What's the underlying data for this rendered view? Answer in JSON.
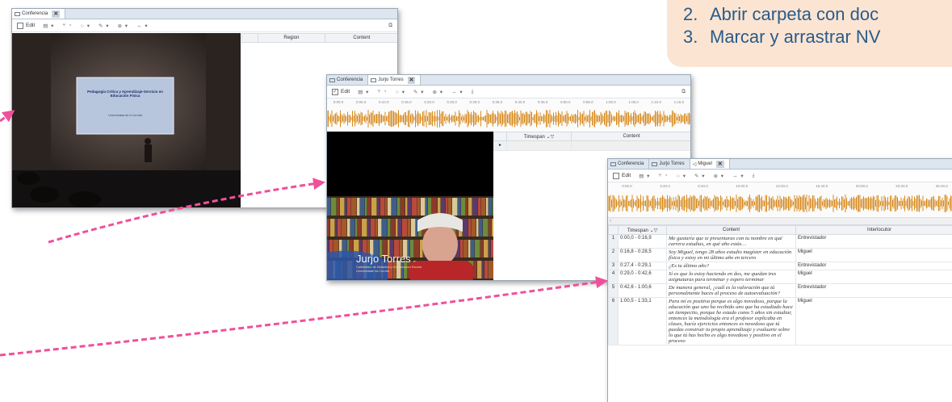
{
  "instructions": {
    "items": [
      {
        "num": "2.",
        "text": "Abrir carpeta con doc"
      },
      {
        "num": "3.",
        "text": "Marcar y arrastrar NV"
      }
    ]
  },
  "win1": {
    "tabs": [
      {
        "label": "Conferencia"
      }
    ],
    "edit_label": "Edit",
    "columns": {
      "region": "Region",
      "content": "Content"
    },
    "video": {
      "slide_title": "Pedagogía Crítica y Aprendizaje-Servicio en Educación Física",
      "slide_sub": "Universidad de A Coruña"
    }
  },
  "win2": {
    "tabs": [
      {
        "label": "Conferencia"
      },
      {
        "label": "Jurjo Torres"
      }
    ],
    "edit_label": "Edit",
    "columns": {
      "timespan": "Timespan",
      "content": "Content"
    },
    "ruler": [
      "0:00.0",
      "0:05.0",
      "0:10.0",
      "0:15.0",
      "0:20.0",
      "0:25.0",
      "0:30.0",
      "0:35.0",
      "0:40.0",
      "0:45.0",
      "0:50.0",
      "0:55.0",
      "1:00.0",
      "1:05.0",
      "1:10.0",
      "1:15.0"
    ],
    "video": {
      "caption_name": "Jurjo Torres",
      "caption_line1": "Catedrático de Didáctica y Organización Escolar",
      "caption_line2": "Universidade da Coruña"
    }
  },
  "win3": {
    "tabs": [
      {
        "label": "Conferencia"
      },
      {
        "label": "Jurjo Torres"
      },
      {
        "label": "Miguel"
      }
    ],
    "edit_label": "Edit",
    "ruler": [
      "0:00.0",
      "3:20.0",
      "6:40.0",
      "10:00.0",
      "13:20.0",
      "16:40.0",
      "20:00.0",
      "23:20.0",
      "26:40.0"
    ],
    "columns": {
      "timespan": "Timespan",
      "content": "Content",
      "speaker": "Interlocutor"
    },
    "rows": [
      {
        "n": "1",
        "ts": "0:00,0 - 0:16,9",
        "content": "Me gustaría que te presentaras con tu nombre en qué carrera estudias, en qué año estás…",
        "speaker": "Entrevistador",
        "q": true
      },
      {
        "n": "2",
        "ts": "0:16,8 - 0:28,5",
        "content": "Soy Miguel, tengo 28 años estudio magíster en educación física y estoy en mi último año en tercero",
        "speaker": "Miguel",
        "q": false
      },
      {
        "n": "3",
        "ts": "0:27,4 - 0:29,1",
        "content": "¿Es tu último año?",
        "speaker": "Entrevistador",
        "q": true
      },
      {
        "n": "4",
        "ts": "0:29,0 - 0:42,6",
        "content": "Sí es que lo estoy haciendo en dos, me quedan tres asignaturas para terminar y espero terminar",
        "speaker": "Miguel",
        "q": false
      },
      {
        "n": "5",
        "ts": "0:42,6 - 1:00,6",
        "content": "De manera general, ¿cuál es la valoración que tú personalmente haces al proceso de autoevaluación?",
        "speaker": "Entrevistador",
        "q": true
      },
      {
        "n": "6",
        "ts": "1:00,5 - 1:33,1",
        "content": "Para mí es positiva porque es algo novedoso, porque la educación que uno ha recibido uno que ha estudiado hace un tiempecito, porque he estado como 5 años sin estudiar, entonces la metodología era el profesor explicaba en clases, hacía ejercicios entonces es novedoso que tú puedas construir tu propio aprendizaje y evaluarte sobre lo que tú has hecho es algo novedoso y positivo en el proceso",
        "speaker": "Miguel",
        "q": false
      }
    ]
  },
  "colors": {
    "arrow": "#f0509a",
    "instr_bg": "#fbe5d2",
    "instr_text": "#2a5b8a",
    "question_text": "#3a6fd4",
    "waveform": "#d78a1e"
  }
}
